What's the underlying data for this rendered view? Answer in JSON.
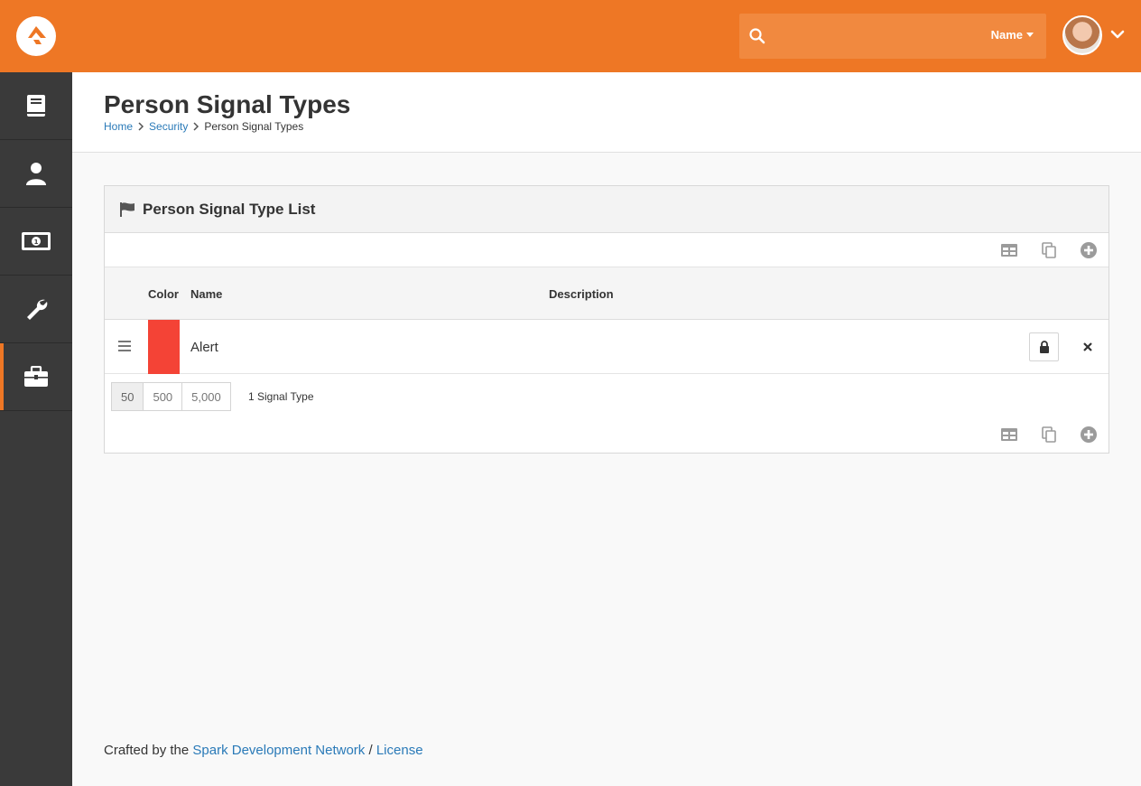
{
  "header": {
    "search": {
      "placeholder": "",
      "filter_label": "Name"
    },
    "colors": {
      "brand": "#ee7725",
      "search_bg": "#f1893f"
    }
  },
  "sidebar": {
    "items": [
      {
        "icon": "book-icon",
        "active": false
      },
      {
        "icon": "person-icon",
        "active": false
      },
      {
        "icon": "money-icon",
        "active": false
      },
      {
        "icon": "wrench-icon",
        "active": false
      },
      {
        "icon": "briefcase-icon",
        "active": true
      }
    ]
  },
  "page": {
    "title": "Person Signal Types",
    "breadcrumb": [
      "Home",
      "Security",
      "Person Signal Types"
    ]
  },
  "panel": {
    "title": "Person Signal Type List",
    "columns": {
      "color": "Color",
      "name": "Name",
      "description": "Description"
    },
    "rows": [
      {
        "color": "#f44336",
        "name": "Alert",
        "description": ""
      }
    ],
    "page_sizes": [
      "50",
      "500",
      "5,000"
    ],
    "count_label": "1 Signal Type"
  },
  "footer": {
    "prefix": "Crafted by the",
    "link": "Spark Development Network",
    "separator": "/",
    "license": "License"
  }
}
